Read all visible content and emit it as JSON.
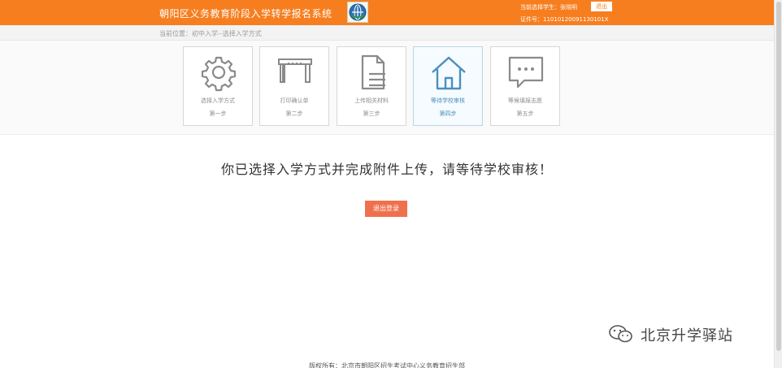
{
  "header": {
    "title": "朝阳区义务教育阶段入学转学报名系统",
    "user_label": "当前选择学生：",
    "user_name": "张晓明",
    "logout_label": "退出",
    "id_text": "证件号：11010120091130101X"
  },
  "breadcrumb": {
    "text": "当前位置：初中入学--选择入学方式"
  },
  "steps": [
    {
      "label": "选择入学方式",
      "num": "第一步",
      "icon": "gear-icon",
      "active": false
    },
    {
      "label": "打印确认单",
      "num": "第二步",
      "icon": "printer-icon",
      "active": false
    },
    {
      "label": "上传相关材料",
      "num": "第三步",
      "icon": "document-icon",
      "active": false
    },
    {
      "label": "等待学校审核",
      "num": "第四步",
      "icon": "house-icon",
      "active": true
    },
    {
      "label": "等候填报志愿",
      "num": "第五步",
      "icon": "chat-icon",
      "active": false
    }
  ],
  "main": {
    "message": "你已选择入学方式并完成附件上传，请等待学校审核！",
    "logout_button": "退出登录"
  },
  "watermark": {
    "text": "北京升学驿站",
    "icon": "wechat-icon"
  },
  "footer": {
    "text": "版权所有：北京市朝阳区招生考试中心义务教育招生部"
  },
  "colors": {
    "header": "#f77e1f",
    "active_step": "#4b8fbd",
    "logout_button": "#f0704d"
  }
}
